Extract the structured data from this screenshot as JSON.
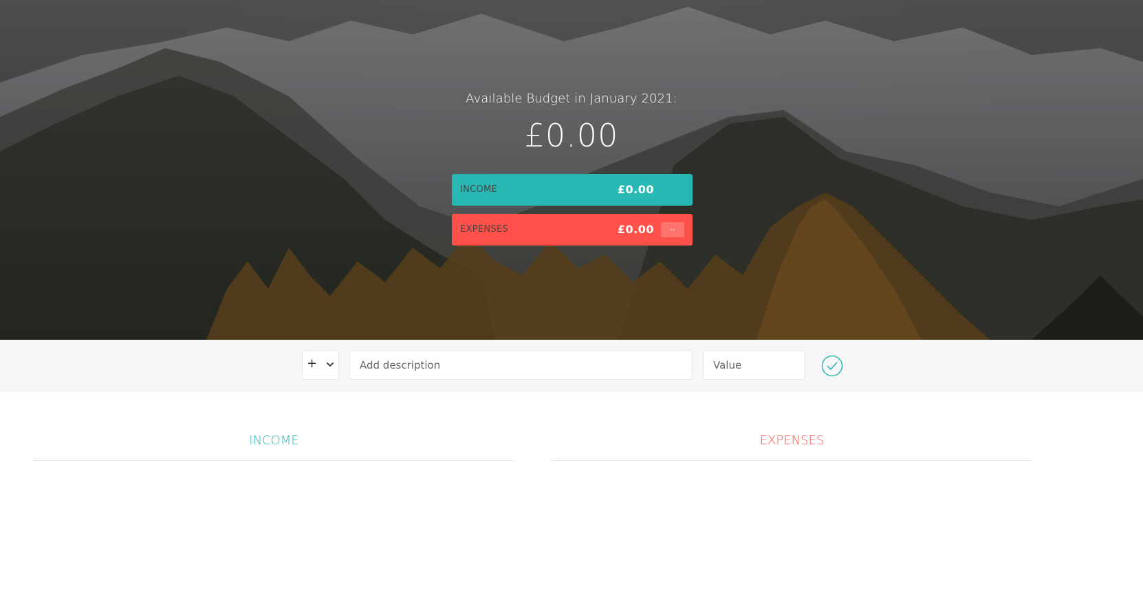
{
  "budget": {
    "title": "Available Budget in January 2021:",
    "value": "£0.00"
  },
  "summary": {
    "income": {
      "label": "Income",
      "value": "£0.00"
    },
    "expenses": {
      "label": "Expenses",
      "value": "£0.00",
      "percentage": "--"
    }
  },
  "add": {
    "type_selected": "+",
    "description_placeholder": "Add description",
    "value_placeholder": "Value",
    "submit_icon": "checkmark-circle-icon"
  },
  "lists": {
    "income_title": "Income",
    "expenses_title": "Expenses"
  },
  "colors": {
    "income": "#28b9b5",
    "expenses": "#ff5049"
  }
}
